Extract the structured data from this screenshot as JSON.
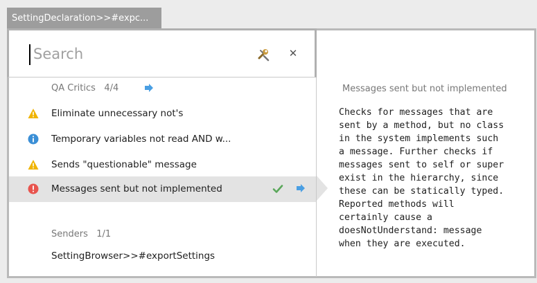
{
  "window": {
    "title": "SettingDeclaration>>#expc..."
  },
  "search": {
    "placeholder": "Search",
    "value": ""
  },
  "icons": {
    "tools": "wrench-icon",
    "close": "close-icon",
    "arrow": "arrow-right-icon",
    "check": "checkmark-icon"
  },
  "colors": {
    "warning": "#f0b400",
    "info": "#3b8fd6",
    "error": "#e8544e",
    "arrow": "#4a9fe3",
    "check": "#5aa75a"
  },
  "groups": [
    {
      "title": "QA Critics",
      "count": "4/4",
      "items": [
        {
          "severity": "warning",
          "label": "Eliminate unnecessary not's"
        },
        {
          "severity": "info",
          "label": "Temporary variables not read AND w..."
        },
        {
          "severity": "warning",
          "label": "Sends \"questionable\" message"
        },
        {
          "severity": "error",
          "label": "Messages sent but not implemented",
          "selected": true
        }
      ]
    },
    {
      "title": "Senders",
      "count": "1/1",
      "items": [
        {
          "label": "SettingBrowser>>#exportSettings"
        }
      ]
    }
  ],
  "detail": {
    "title": "Messages sent but not implemented",
    "body": "Checks for messages that are\nsent by a method, but no class\nin the system implements such\na message. Further checks if\nmessages sent to self or super\nexist in the hierarchy, since\nthese can be statically typed.\nReported methods will\ncertainly cause a\ndoesNotUnderstand: message\nwhen they are executed."
  }
}
